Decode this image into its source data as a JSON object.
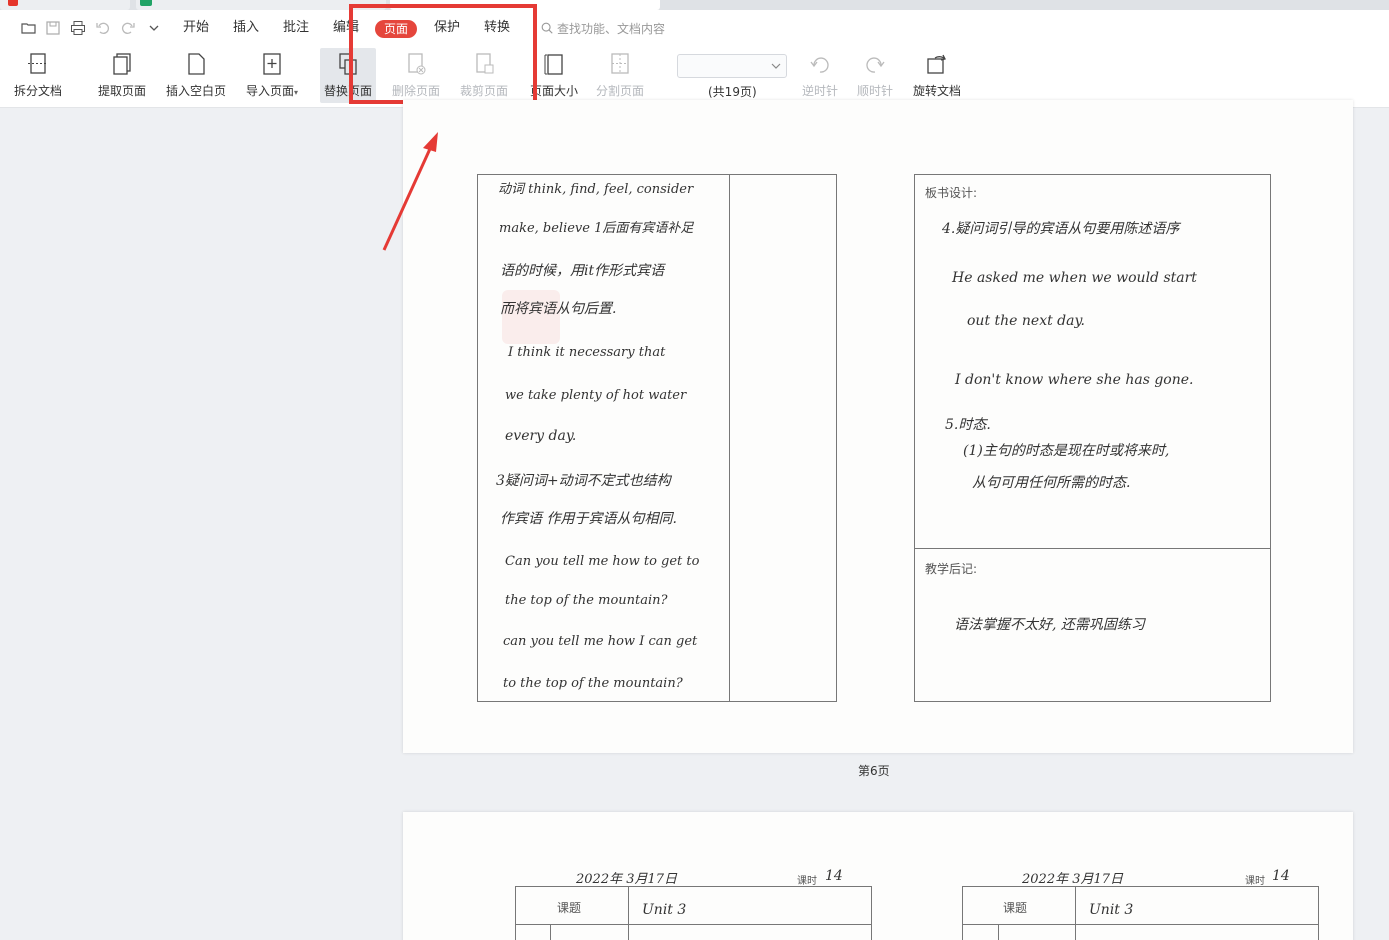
{
  "menu": {
    "items": [
      "开始",
      "插入",
      "批注",
      "编辑",
      "页面",
      "保护",
      "转换"
    ],
    "active": "页面",
    "search_placeholder": "查找功能、文档内容"
  },
  "ribbon": {
    "split": "拆分文档",
    "extract": "提取页面",
    "insert_blank": "插入空白页",
    "import": "导入页面",
    "replace": "替换页面",
    "delete": "删除页面",
    "crop": "裁剪页面",
    "size": "页面大小",
    "divide": "分割页面",
    "page_count": "(共19页)",
    "ccw": "逆时针",
    "cw": "顺时针",
    "rotate_doc": "旋转文档"
  },
  "colors": {
    "accent": "#e5463c",
    "highlight_box": "#e53a35"
  },
  "document": {
    "page_label": "第6页",
    "left_lines": [
      "动词 think, find, feel, consider",
      "make, believe 1后面有宾语补足",
      "语的时候，用it作形式宾语",
      "而将宾语从句后置.",
      "I think it necessary that",
      "we take plenty of hot water",
      "every day.",
      "3疑问词+动词不定式也结构",
      "作宾语 作用于宾语从句相同.",
      "Can you tell me how to get to",
      "the top of the mountain?",
      "can you tell me how I can get",
      "to the top of the mountain?"
    ],
    "board_title": "板书设计:",
    "right_lines": [
      "4.疑问词引导的宾语从句要用陈述语序",
      "He asked me when we would start",
      "out the next day.",
      "I don't know where she has gone.",
      "5.时态.",
      "(1)主句的时态是现在时或将来时,",
      "从句可用任何所需的时态."
    ],
    "notes_title": "教学后记:",
    "notes_line": "语法掌握不太好, 还需巩固练习",
    "next_page": {
      "date_left": "2022年 3月17日",
      "date_right": "2022年 3月17日",
      "period_label": "课时",
      "period_value": "14",
      "topic_label": "课题",
      "topic_value": "Unit 3"
    }
  }
}
